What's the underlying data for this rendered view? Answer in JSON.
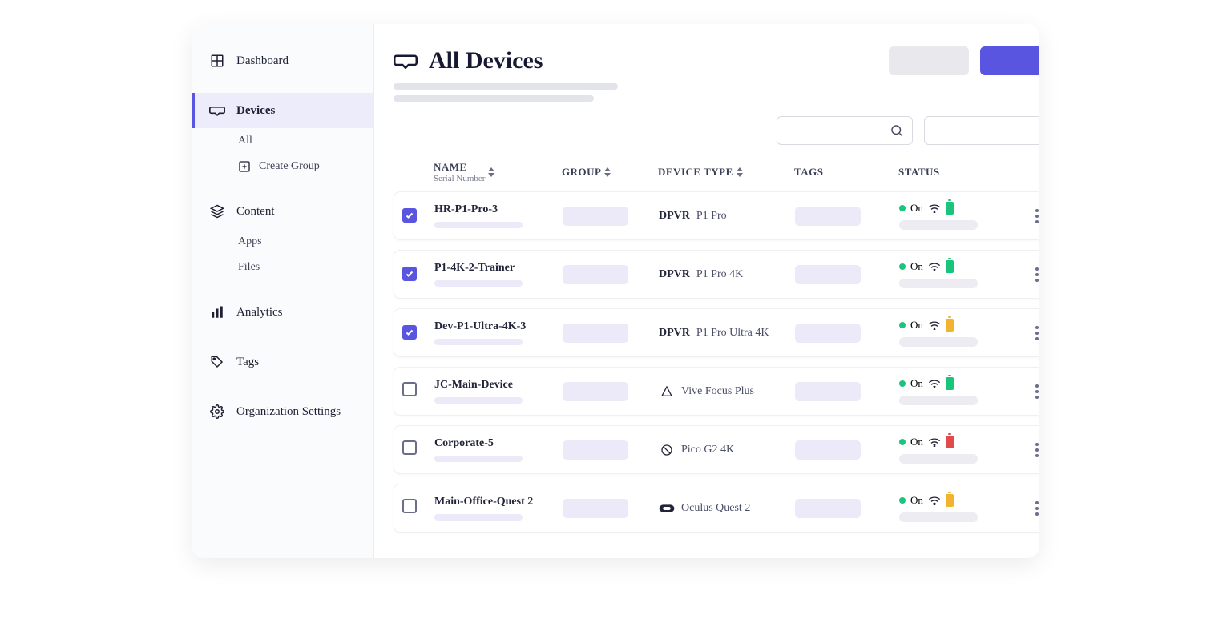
{
  "sidebar": {
    "dashboard": "Dashboard",
    "devices": "Devices",
    "devices_all": "All",
    "devices_create_group": "Create Group",
    "content": "Content",
    "content_apps": "Apps",
    "content_files": "Files",
    "analytics": "Analytics",
    "tags": "Tags",
    "org_settings": "Organization Settings"
  },
  "page": {
    "title": "All Devices"
  },
  "columns": {
    "name": "NAME",
    "name_sub": "Serial Number",
    "group": "GROUP",
    "device_type": "DEVICE TYPE",
    "tags": "TAGS",
    "status": "STATUS"
  },
  "status_on": "On",
  "rows": [
    {
      "checked": true,
      "name": "HR-P1-Pro-3",
      "dt_icon": "dpvr",
      "dt_brand": "DPVR",
      "dt_model": "P1 Pro",
      "battery": "full"
    },
    {
      "checked": true,
      "name": "P1-4K-2-Trainer",
      "dt_icon": "dpvr",
      "dt_brand": "DPVR",
      "dt_model": "P1 Pro 4K",
      "battery": "charge"
    },
    {
      "checked": true,
      "name": "Dev-P1-Ultra-4K-3",
      "dt_icon": "dpvr",
      "dt_brand": "DPVR",
      "dt_model": "P1 Pro Ultra 4K",
      "battery": "mid"
    },
    {
      "checked": false,
      "name": "JC-Main-Device",
      "dt_icon": "vive",
      "dt_brand": "",
      "dt_model": "Vive Focus Plus",
      "battery": "full"
    },
    {
      "checked": false,
      "name": "Corporate-5",
      "dt_icon": "pico",
      "dt_brand": "",
      "dt_model": "Pico G2 4K",
      "battery": "low"
    },
    {
      "checked": false,
      "name": "Main-Office-Quest 2",
      "dt_icon": "oculus",
      "dt_brand": "",
      "dt_model": "Oculus Quest 2",
      "battery": "mid"
    }
  ]
}
